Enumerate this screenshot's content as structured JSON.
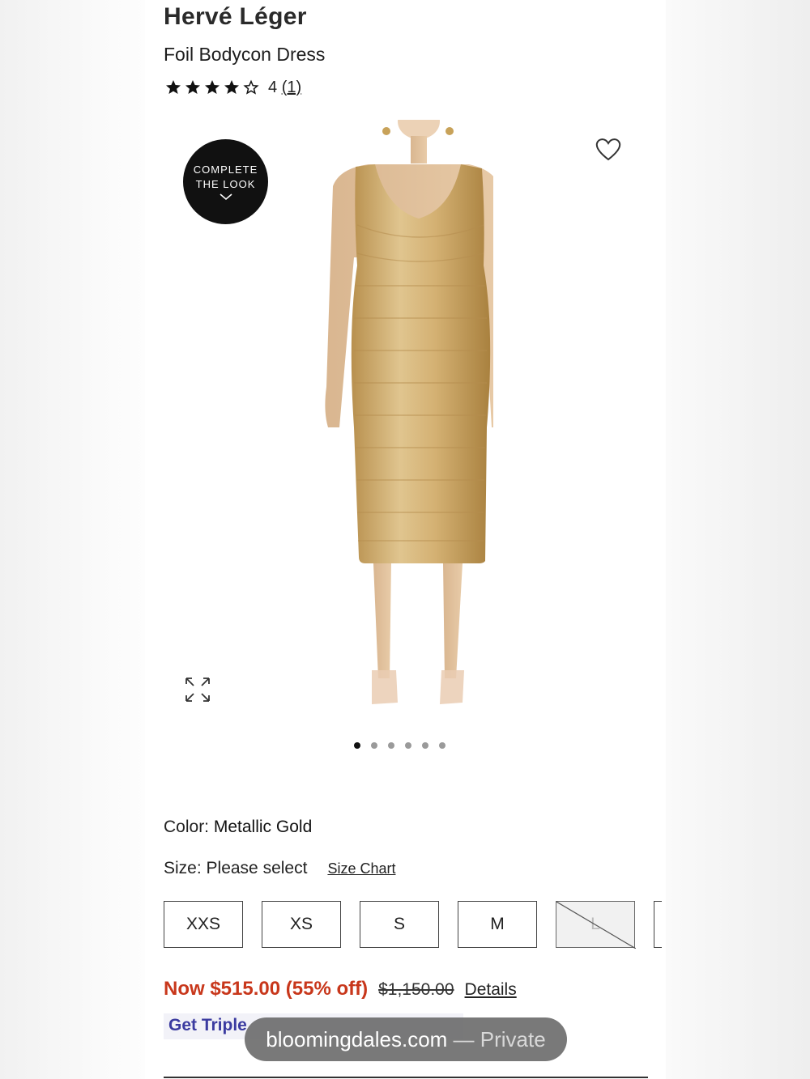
{
  "product": {
    "brand": "Hervé Léger",
    "name": "Foil Bodycon Dress",
    "rating": 4,
    "rating_max": 5,
    "rating_value_text": "4",
    "review_count_text": "(1)"
  },
  "gallery": {
    "complete_look_line1": "COMPLETE",
    "complete_look_line2": "THE LOOK",
    "slide_count": 6,
    "active_slide": 0
  },
  "options": {
    "color_label": "Color:",
    "color_value": "Metallic Gold",
    "size_label": "Size: Please select",
    "size_chart_label": "Size Chart",
    "sizes": [
      {
        "label": "XXS",
        "available": true
      },
      {
        "label": "XS",
        "available": true
      },
      {
        "label": "S",
        "available": true
      },
      {
        "label": "M",
        "available": true
      },
      {
        "label": "L",
        "available": false
      }
    ]
  },
  "pricing": {
    "now_text": "Now $515.00 (55% off)",
    "original_price": "$1,150.00",
    "details_label": "Details",
    "promo_text": "Get Triple"
  },
  "browser": {
    "domain": "bloomingdales.com",
    "mode": "— Private"
  },
  "colors": {
    "sale_red": "#c8371b",
    "promo_blue": "#3b3ba0",
    "gold": "#c9a467"
  },
  "icons": [
    "star-icon",
    "heart-icon",
    "chevron-down-icon",
    "expand-icon"
  ]
}
